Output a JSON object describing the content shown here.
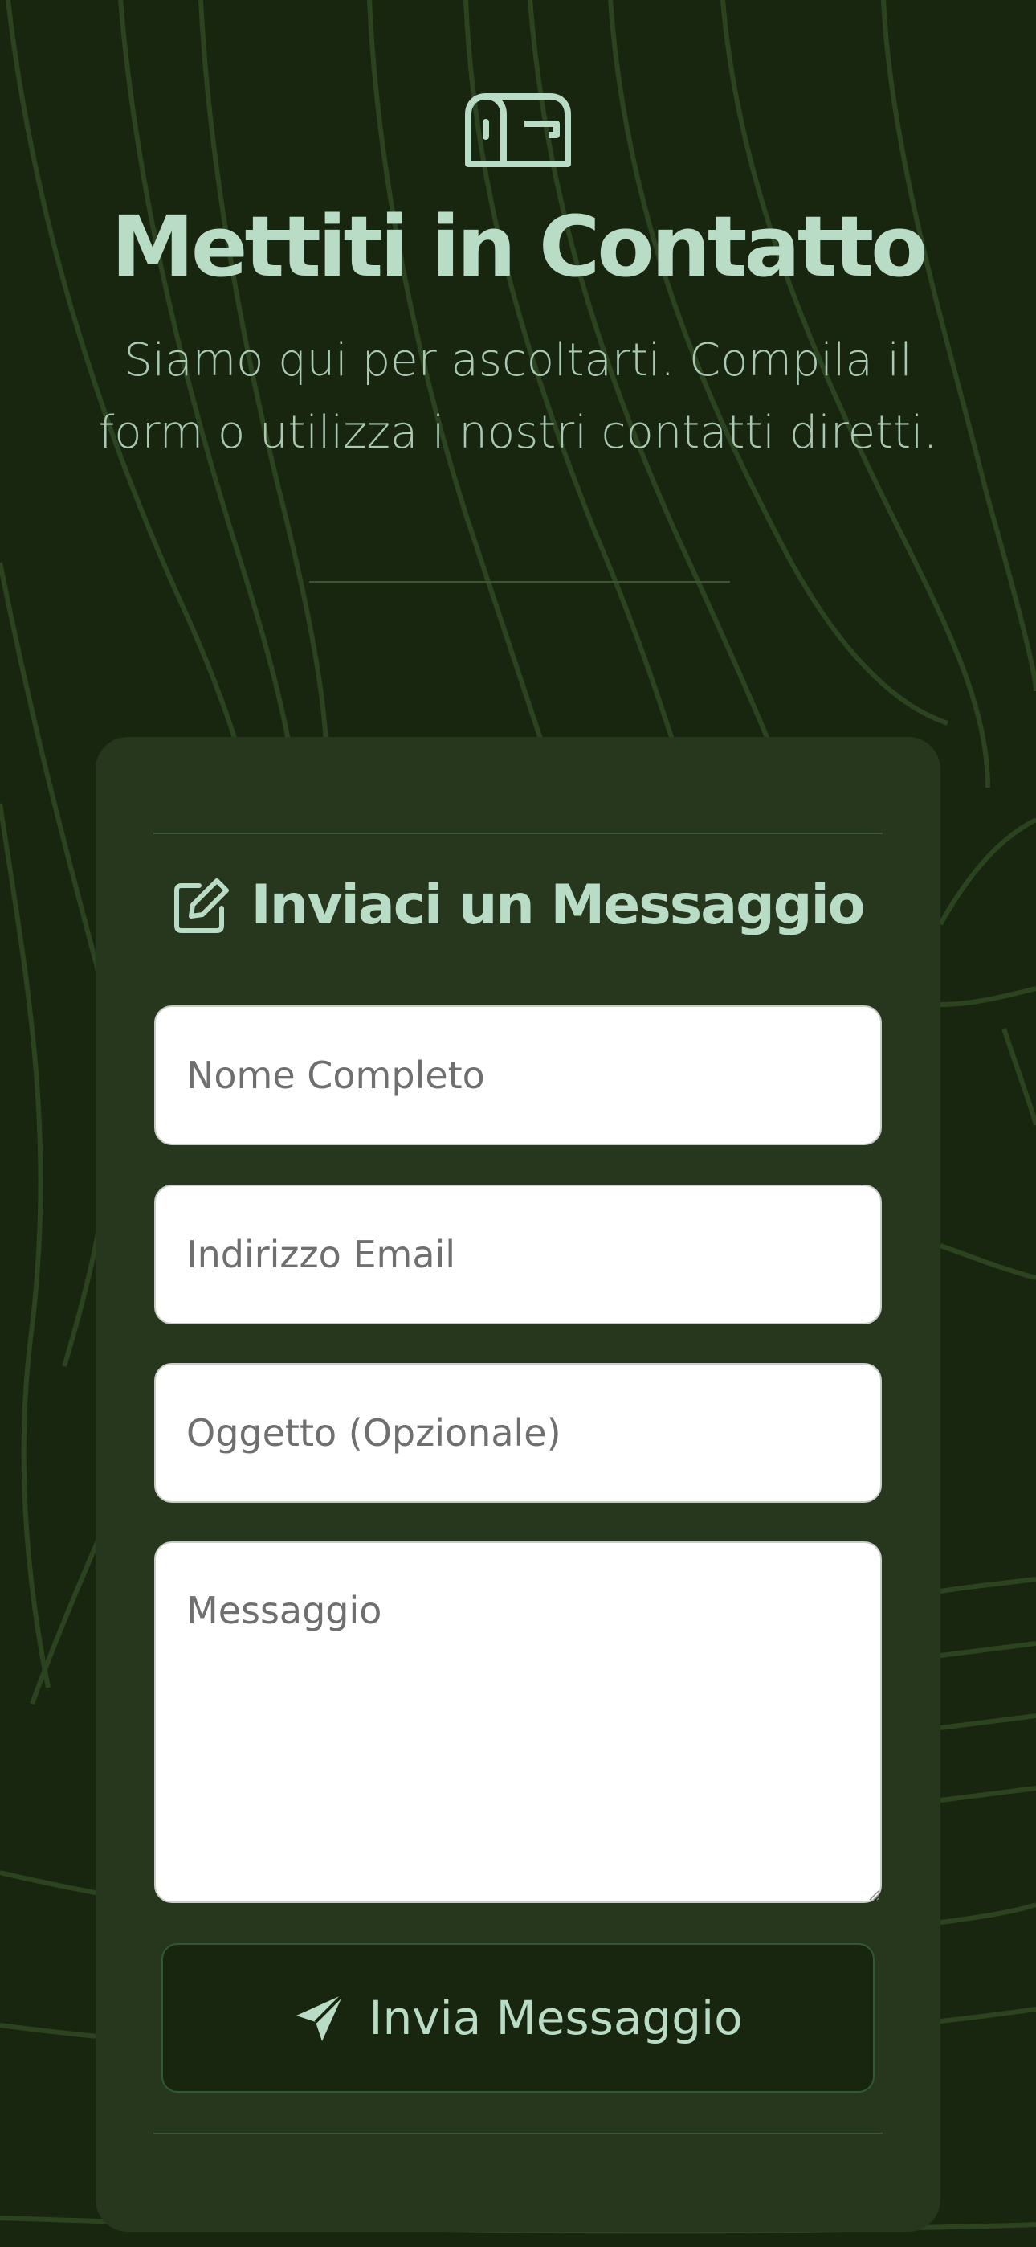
{
  "colors": {
    "background": "#19260f",
    "card": "#26371e",
    "accent": "#b9dcc6",
    "subtitle": "#a9c9b4",
    "contour_lines": "#2c4320"
  },
  "hero": {
    "icon": "mailbox-icon",
    "title": "Mettiti in Contatto",
    "subtitle": "Siamo qui per ascoltarti. Compila il form o utilizza i nostri contatti diretti."
  },
  "form": {
    "icon": "edit-icon",
    "heading": "Inviaci un Messaggio",
    "fields": {
      "name": {
        "placeholder": "Nome Completo",
        "value": ""
      },
      "email": {
        "placeholder": "Indirizzo Email",
        "value": ""
      },
      "subject": {
        "placeholder": "Oggetto (Opzionale)",
        "value": ""
      },
      "message": {
        "placeholder": "Messaggio",
        "value": ""
      }
    },
    "submit": {
      "icon": "send-icon",
      "label": "Invia Messaggio"
    }
  }
}
